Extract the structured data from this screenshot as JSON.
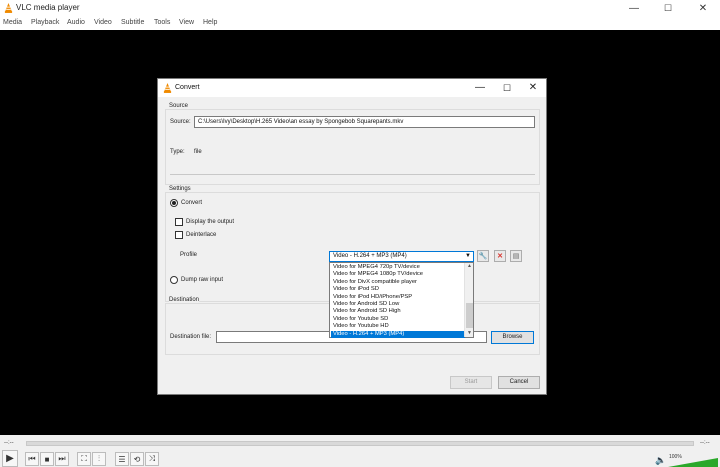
{
  "window": {
    "title": "VLC media player",
    "controls": {
      "minimize": "—",
      "maximize": "☐",
      "close": "✕"
    }
  },
  "menu": [
    "Media",
    "Playback",
    "Audio",
    "Video",
    "Subtitle",
    "Tools",
    "View",
    "Help"
  ],
  "player": {
    "time_elapsed": "--:--",
    "time_total": "--:--",
    "volume": "100%"
  },
  "dialog": {
    "title": "Convert",
    "controls": {
      "minimize": "—",
      "maximize": "☐",
      "close": "✕"
    },
    "source": {
      "group_title": "Source",
      "source_label": "Source:",
      "source_value": "C:\\Users\\Ivy\\Desktop\\H.265 Video\\an essay by Spongebob Squarepants.mkv",
      "type_label": "Type:",
      "type_value": "file"
    },
    "settings": {
      "group_title": "Settings",
      "convert_label": "Convert",
      "display_output_label": "Display the output",
      "deinterlace_label": "Deinterlace",
      "profile_label": "Profile",
      "profile_selected": "Video - H.264 + MP3 (MP4)",
      "dump_raw_label": "Dump raw input",
      "profile_options": [
        "Video for MPEG4 720p TV/device",
        "Video for MPEG4 1080p TV/device",
        "Video for DivX compatible player",
        "Video for iPod SD",
        "Video for iPod HD/iPhone/PSP",
        "Video for Android SD Low",
        "Video for Android SD High",
        "Video for Youtube SD",
        "Video for Youtube HD",
        "Video - H.264 + MP3 (MP4)"
      ],
      "profile_selected_index": 9,
      "edit_profile_icon": "wrench-icon",
      "delete_profile_icon": "red-x-icon",
      "new_profile_icon": "list-icon",
      "delete_color": "#d9312b"
    },
    "destination": {
      "group_title": "Destination",
      "file_label": "Destination file:",
      "file_value": "",
      "browse_label": "Browse"
    },
    "start_label": "Start",
    "cancel_label": "Cancel"
  }
}
